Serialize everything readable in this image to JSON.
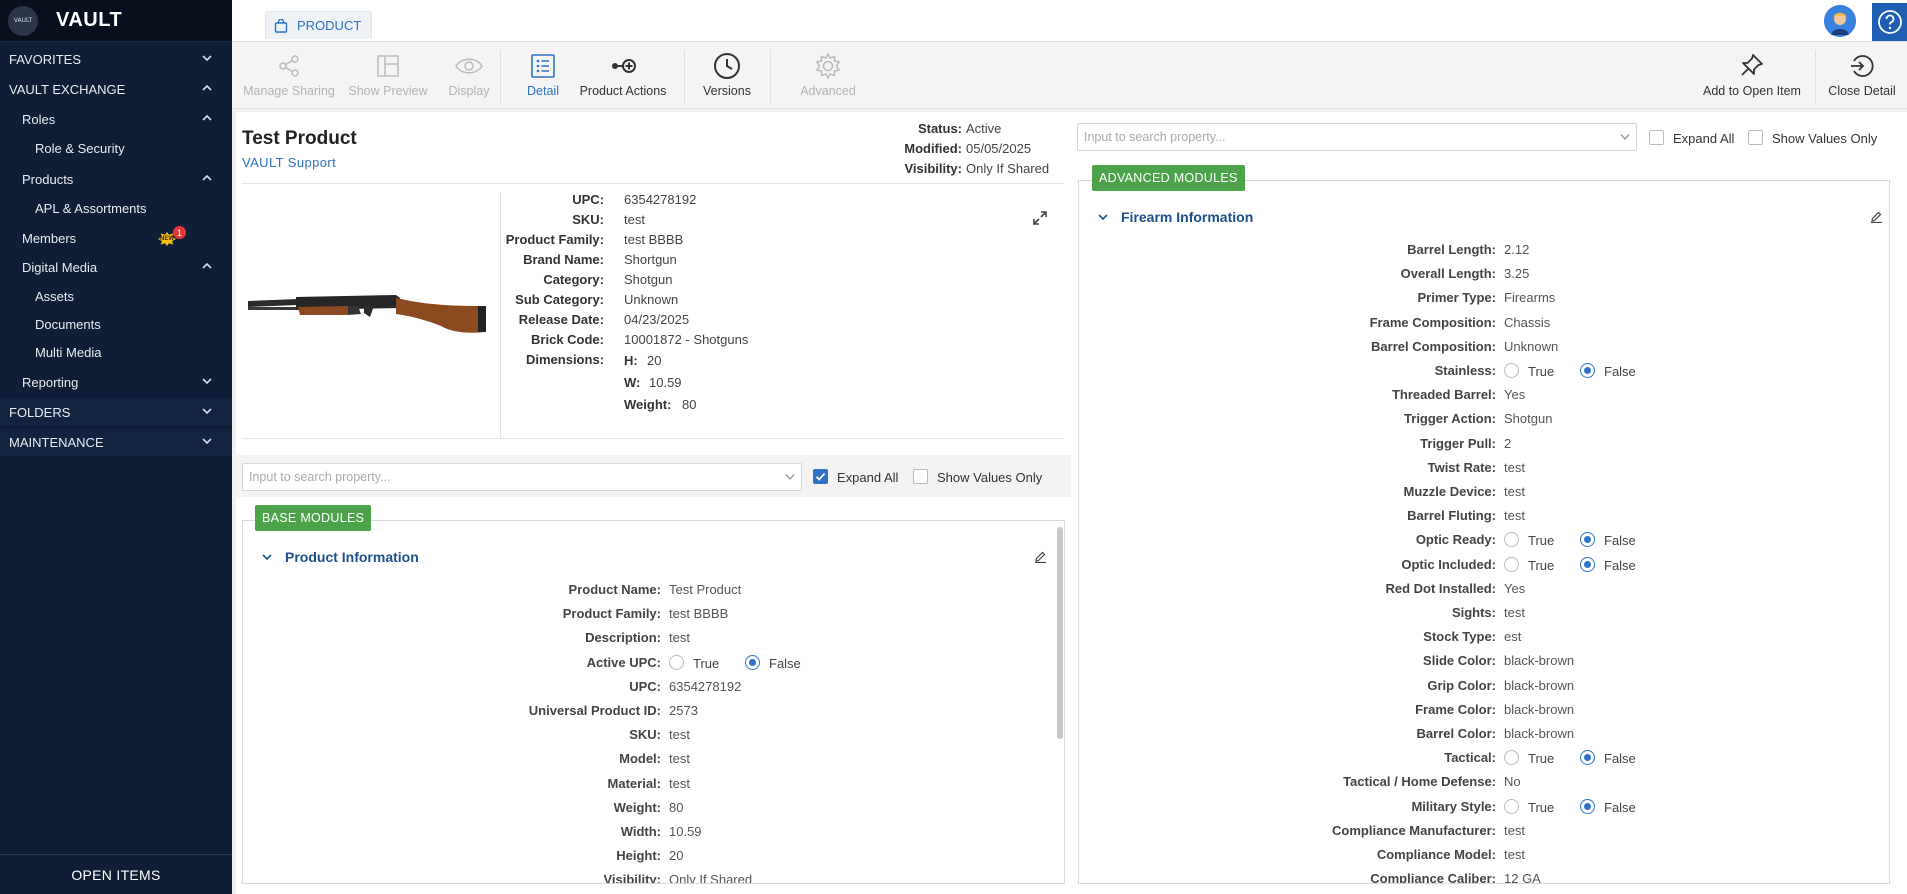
{
  "brand": {
    "logo_text": "VAULT",
    "name": "VAULT"
  },
  "sidebar": {
    "favorites": "FAVORITES",
    "vault_exchange": "VAULT EXCHANGE",
    "roles": "Roles",
    "role_security": "Role & Security",
    "products": "Products",
    "apl": "APL & Assortments",
    "members": "Members",
    "members_badge_text": "NEW",
    "members_badge_count": "1",
    "digital_media": "Digital Media",
    "assets": "Assets",
    "documents": "Documents",
    "multi_media": "Multi Media",
    "reporting": "Reporting",
    "folders": "FOLDERS",
    "maintenance": "MAINTENANCE",
    "open_items": "OPEN ITEMS"
  },
  "tab": {
    "label": "PRODUCT"
  },
  "toolbar": {
    "manage_sharing": "Manage Sharing",
    "show_preview": "Show Preview",
    "display": "Display",
    "detail": "Detail",
    "product_actions": "Product Actions",
    "versions": "Versions",
    "advanced": "Advanced",
    "add_to_open_item": "Add to Open Item",
    "close_detail": "Close Detail"
  },
  "product": {
    "title": "Test Product",
    "subtitle": "VAULT Support",
    "status_label": "Status:",
    "status": "Active",
    "modified_label": "Modified:",
    "modified": "05/05/2025",
    "visibility_label": "Visibility:",
    "visibility": "Only If Shared"
  },
  "summary": {
    "upc_l": "UPC:",
    "upc": "6354278192",
    "sku_l": "SKU:",
    "sku": "test",
    "family_l": "Product Family:",
    "family": "test BBBB",
    "brand_l": "Brand Name:",
    "brand": "Shortgun",
    "category_l": "Category:",
    "category": "Shotgun",
    "subcat_l": "Sub Category:",
    "subcat": "Unknown",
    "release_l": "Release Date:",
    "release": "04/23/2025",
    "brick_l": "Brick Code:",
    "brick": "10001872 - Shotguns",
    "dims_l": "Dimensions:",
    "h_l": "H:",
    "h": "20",
    "w_l": "W:",
    "w": "10.59",
    "weight_l": "Weight:",
    "weight": "80"
  },
  "left_search": {
    "placeholder": "Input to search property...",
    "expand_all": "Expand All",
    "show_values_only": "Show Values Only",
    "expand_checked": true
  },
  "right_search": {
    "placeholder": "Input to search property...",
    "expand_all": "Expand All",
    "show_values_only": "Show Values Only",
    "expand_checked": false
  },
  "base_modules": {
    "badge": "BASE MODULES",
    "title": "Product Information",
    "true_label": "True",
    "false_label": "False",
    "rows": [
      {
        "label": "Product Name:",
        "value": "Test Product"
      },
      {
        "label": "Product Family:",
        "value": "test BBBB"
      },
      {
        "label": "Description:",
        "value": "test"
      },
      {
        "label": "Active UPC:",
        "radio": "False"
      },
      {
        "label": "UPC:",
        "value": "6354278192"
      },
      {
        "label": "Universal Product ID:",
        "value": "2573"
      },
      {
        "label": "SKU:",
        "value": "test"
      },
      {
        "label": "Model:",
        "value": "test"
      },
      {
        "label": "Material:",
        "value": "test"
      },
      {
        "label": "Weight:",
        "value": "80"
      },
      {
        "label": "Width:",
        "value": "10.59"
      },
      {
        "label": "Height:",
        "value": "20"
      },
      {
        "label": "Visibility:",
        "value": "Only If Shared"
      }
    ]
  },
  "advanced_modules": {
    "badge": "ADVANCED MODULES",
    "title": "Firearm Information",
    "true_label": "True",
    "false_label": "False",
    "rows": [
      {
        "label": "Barrel Length:",
        "value": "2.12"
      },
      {
        "label": "Overall Length:",
        "value": "3.25"
      },
      {
        "label": "Primer Type:",
        "value": "Firearms"
      },
      {
        "label": "Frame Composition:",
        "value": "Chassis"
      },
      {
        "label": "Barrel Composition:",
        "value": "Unknown"
      },
      {
        "label": "Stainless:",
        "radio": "False"
      },
      {
        "label": "Threaded Barrel:",
        "value": "Yes"
      },
      {
        "label": "Trigger Action:",
        "value": "Shotgun"
      },
      {
        "label": "Trigger Pull:",
        "value": "2"
      },
      {
        "label": "Twist Rate:",
        "value": "test"
      },
      {
        "label": "Muzzle Device:",
        "value": "test"
      },
      {
        "label": "Barrel Fluting:",
        "value": "test"
      },
      {
        "label": "Optic Ready:",
        "radio": "False"
      },
      {
        "label": "Optic Included:",
        "radio": "False"
      },
      {
        "label": "Red Dot Installed:",
        "value": "Yes"
      },
      {
        "label": "Sights:",
        "value": "test"
      },
      {
        "label": "Stock Type:",
        "value": "est"
      },
      {
        "label": "Slide Color:",
        "value": "black-brown"
      },
      {
        "label": "Grip Color:",
        "value": "black-brown"
      },
      {
        "label": "Frame Color:",
        "value": "black-brown"
      },
      {
        "label": "Barrel Color:",
        "value": "black-brown"
      },
      {
        "label": "Tactical:",
        "radio": "False"
      },
      {
        "label": "Tactical / Home Defense:",
        "value": "No"
      },
      {
        "label": "Military Style:",
        "radio": "False"
      },
      {
        "label": "Compliance Manufacturer:",
        "value": "test"
      },
      {
        "label": "Compliance Model:",
        "value": "test"
      },
      {
        "label": "Compliance Caliber:",
        "value": "12 GA"
      }
    ]
  },
  "colors": {
    "sidebar_bg": "#0f1e36",
    "accent": "#2d72c4",
    "badge_green": "#4ca34a"
  }
}
